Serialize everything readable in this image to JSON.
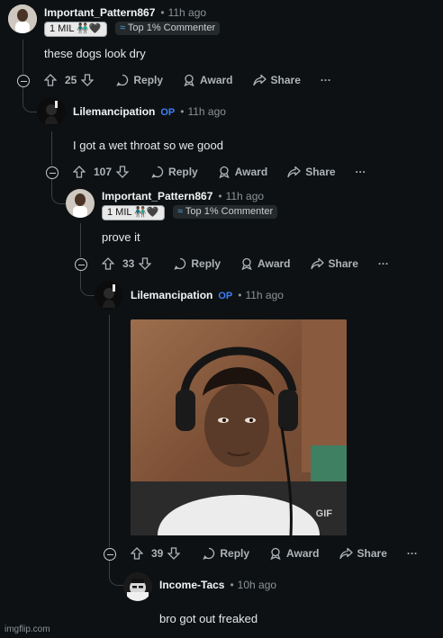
{
  "comments": [
    {
      "username": "Important_Pattern867",
      "time": "11h ago",
      "flair_1": "1 MIL",
      "flair_1_icons": "👨🏿‍🤝‍👨🏾🖤",
      "flair_2": "Top 1% Commenter",
      "text": "these dogs look dry",
      "votes": "25"
    },
    {
      "username": "Lilemancipation",
      "op": "OP",
      "time": "11h ago",
      "text": "I got a wet throat so we good",
      "votes": "107"
    },
    {
      "username": "Important_Pattern867",
      "time": "11h ago",
      "flair_1": "1 MIL",
      "flair_1_icons": "👨🏿‍🤝‍👨🏾🖤",
      "flair_2": "Top 1% Commenter",
      "text": "prove it",
      "votes": "33"
    },
    {
      "username": "Lilemancipation",
      "op": "OP",
      "time": "11h ago",
      "gif_label": "GIF",
      "votes": "39"
    },
    {
      "username": "Income-Tacs",
      "time": "10h ago",
      "text": "bro got out freaked"
    }
  ],
  "actions": {
    "reply": "Reply",
    "award": "Award",
    "share": "Share",
    "more": "···"
  },
  "sep": "•",
  "watermark": "imgflip.com",
  "icons": [
    "upvote-icon",
    "downvote-icon",
    "reply-icon",
    "award-icon",
    "share-icon",
    "more-icon",
    "collapse-icon"
  ],
  "colors": {
    "background": "#0e1113",
    "op": "#3d7ff8",
    "thread_line": "#3a3f42",
    "text": "#d7dadc"
  }
}
